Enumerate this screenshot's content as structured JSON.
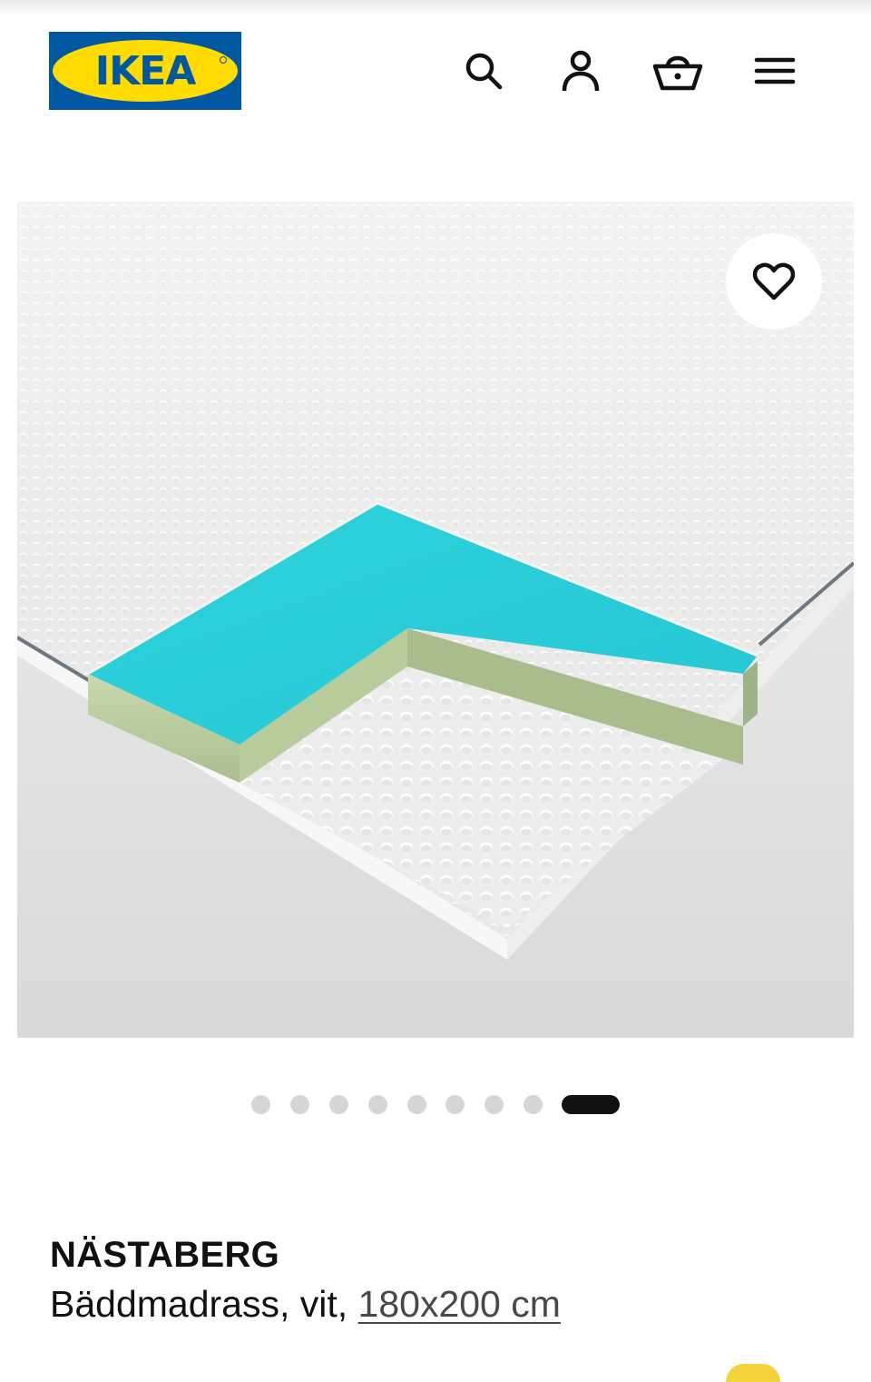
{
  "header": {
    "logo_text": "IKEA",
    "brand_colors": {
      "blue": "#0058a3",
      "yellow": "#ffdb00"
    },
    "icons": [
      "search-icon",
      "user-icon",
      "basket-icon",
      "menu-icon"
    ]
  },
  "media": {
    "favorite_icon": "heart-icon",
    "carousel": {
      "total": 9,
      "active": 9
    }
  },
  "product": {
    "name": "NÄSTABERG",
    "description": "Bäddmadrass, vit,",
    "size": "180x200 cm"
  }
}
